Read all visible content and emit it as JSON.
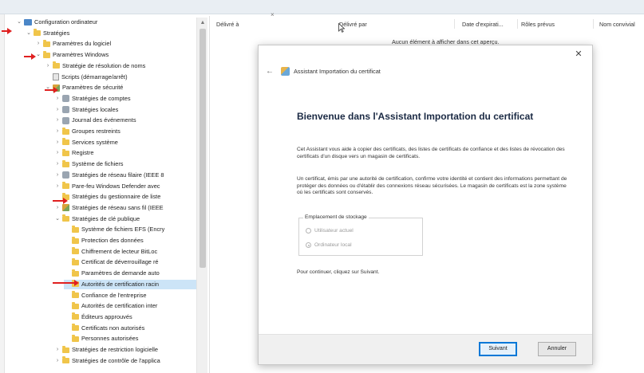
{
  "tree": {
    "items": [
      {
        "label": "Configuration ordinateur",
        "chev": "⌄",
        "icon": "computer",
        "indent": 0
      },
      {
        "label": "Stratégies",
        "chev": "⌄",
        "icon": "folder",
        "indent": 1
      },
      {
        "label": "Paramètres du logiciel",
        "chev": "›",
        "icon": "folder",
        "indent": 2
      },
      {
        "label": "Paramètres Windows",
        "chev": "⌄",
        "icon": "folder",
        "indent": 2
      },
      {
        "label": "Stratégie de résolution de noms",
        "chev": "›",
        "icon": "folder",
        "indent": 3
      },
      {
        "label": "Scripts (démarrage/arrêt)",
        "chev": "",
        "icon": "doc",
        "indent": 3
      },
      {
        "label": "Paramètres de sécurité",
        "chev": "⌄",
        "icon": "policy",
        "indent": 3
      },
      {
        "label": "Stratégies de comptes",
        "chev": "›",
        "icon": "gear",
        "indent": 4
      },
      {
        "label": "Stratégies locales",
        "chev": "›",
        "icon": "gear",
        "indent": 4
      },
      {
        "label": "Journal des événements",
        "chev": "›",
        "icon": "gear",
        "indent": 4
      },
      {
        "label": "Groupes restreints",
        "chev": "›",
        "icon": "folder",
        "indent": 4
      },
      {
        "label": "Services système",
        "chev": "›",
        "icon": "folder",
        "indent": 4
      },
      {
        "label": "Registre",
        "chev": "›",
        "icon": "folder",
        "indent": 4
      },
      {
        "label": "Système de fichiers",
        "chev": "›",
        "icon": "folder",
        "indent": 4
      },
      {
        "label": "Stratégies de réseau filaire (IEEE 8",
        "chev": "›",
        "icon": "gear",
        "indent": 4
      },
      {
        "label": "Pare-feu Windows Defender avec",
        "chev": "›",
        "icon": "folder",
        "indent": 4
      },
      {
        "label": "Stratégies du gestionnaire de liste",
        "chev": "",
        "icon": "folder",
        "indent": 4
      },
      {
        "label": "Stratégies de réseau sans fil (IEEE",
        "chev": "›",
        "icon": "policy",
        "indent": 4
      },
      {
        "label": "Stratégies de clé publique",
        "chev": "⌄",
        "icon": "folder",
        "indent": 4
      },
      {
        "label": "Système de fichiers EFS (Encry",
        "chev": "",
        "icon": "folder",
        "indent": 5
      },
      {
        "label": "Protection des données",
        "chev": "",
        "icon": "folder",
        "indent": 5
      },
      {
        "label": "Chiffrement de lecteur BitLoc",
        "chev": "",
        "icon": "folder",
        "indent": 5
      },
      {
        "label": "Certificat de déverrouillage ré",
        "chev": "",
        "icon": "folder",
        "indent": 5
      },
      {
        "label": "Paramètres de demande auto",
        "chev": "",
        "icon": "folder",
        "indent": 5
      },
      {
        "label": "Autorités de certification racin",
        "chev": "",
        "icon": "folder",
        "indent": 5,
        "selected": true
      },
      {
        "label": "Confiance de l'entreprise",
        "chev": "",
        "icon": "folder",
        "indent": 5
      },
      {
        "label": "Autorités de certification inter",
        "chev": "",
        "icon": "folder",
        "indent": 5
      },
      {
        "label": "Éditeurs approuvés",
        "chev": "",
        "icon": "folder",
        "indent": 5
      },
      {
        "label": "Certificats non autorisés",
        "chev": "",
        "icon": "folder",
        "indent": 5
      },
      {
        "label": "Personnes autorisées",
        "chev": "",
        "icon": "folder",
        "indent": 5
      },
      {
        "label": "Stratégies de restriction logicielle",
        "chev": "›",
        "icon": "folder",
        "indent": 4
      },
      {
        "label": "Stratégies de contrôle de l'applica",
        "chev": "›",
        "icon": "folder",
        "indent": 4
      }
    ]
  },
  "list": {
    "columns": [
      "Délivré à",
      "Délivré par",
      "Date d'expirati...",
      "Rôles prévus",
      "Nom convivial"
    ],
    "empty_message": "Aucun élément à afficher dans cet aperçu."
  },
  "dialog": {
    "wizard_title": "Assistant Importation du certificat",
    "heading": "Bienvenue dans l'Assistant Importation du certificat",
    "paragraph1": "Cet Assistant vous aide à copier des certificats, des listes de certificats de confiance et des listes de révocation des certificats d'un disque vers un magasin de certificats.",
    "paragraph2": "Un certificat, émis par une autorité de certification, confirme votre identité et contient des informations permettant de protéger des données ou d'établir des connexions réseau sécurisées. Le magasin de certificats est la zone système où les certificats sont conservés.",
    "storage_legend": "Emplacement de stockage",
    "option_user": "Utilisateur actuel",
    "option_machine": "Ordinateur local",
    "continue_text": "Pour continuer, cliquez sur Suivant.",
    "next_label": "Suivant",
    "cancel_label": "Annuler",
    "close_glyph": "✕",
    "back_glyph": "←"
  },
  "colors": {
    "annotation_arrow": "#e02020",
    "selected_row": "#cce4f7",
    "primary_border": "#0078d7"
  }
}
